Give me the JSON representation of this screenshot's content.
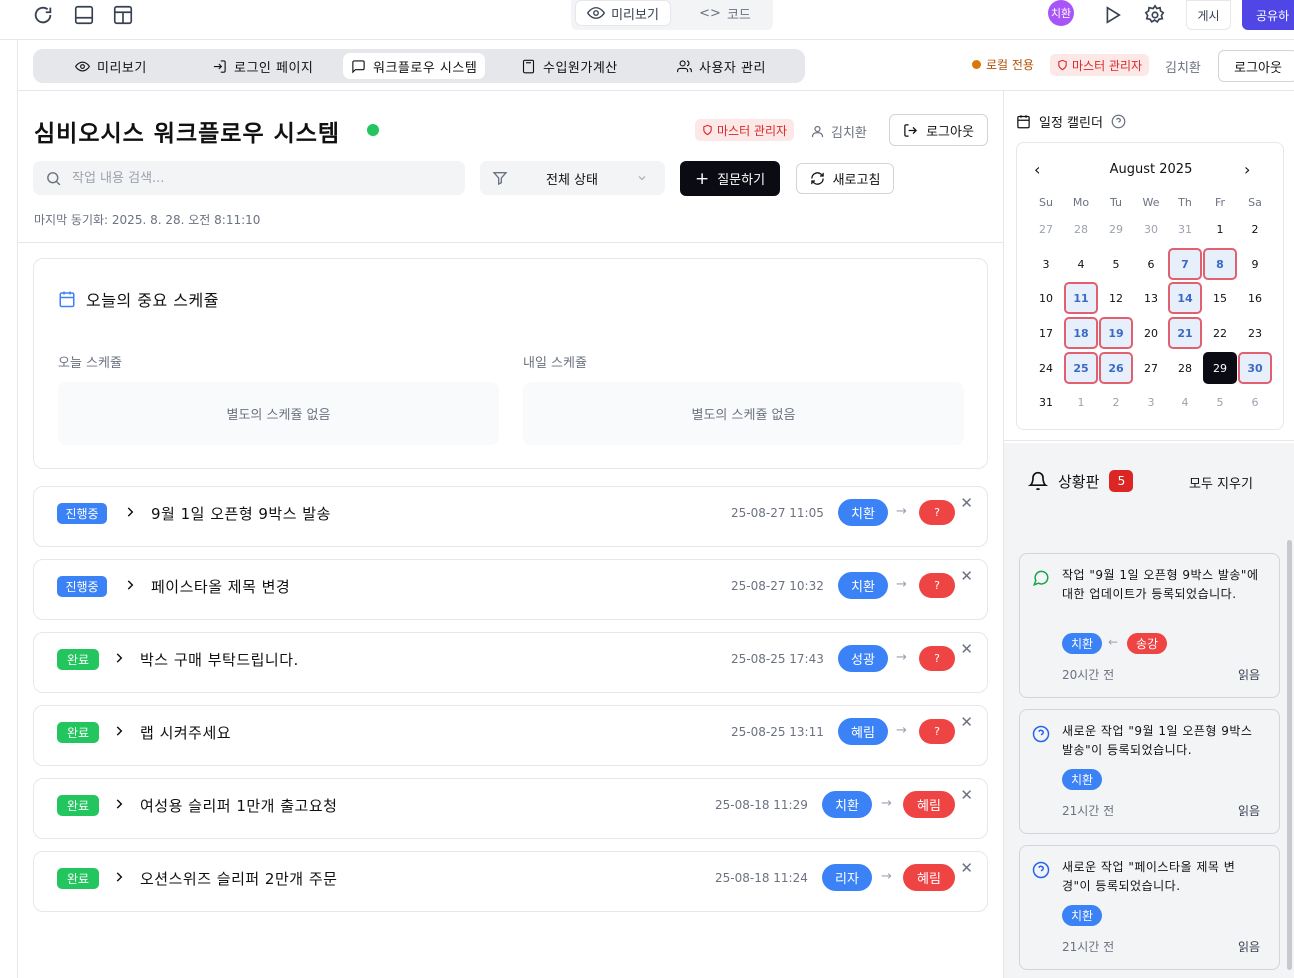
{
  "toolbar": {
    "preview_label": "미리보기",
    "code_label": "코드",
    "avatar_text": "치환",
    "post_label": "게시",
    "share_label": "공유하"
  },
  "nav": {
    "items": [
      {
        "label": "미리보기",
        "icon": "eye-icon"
      },
      {
        "label": "로그인 페이지",
        "icon": "login-icon"
      },
      {
        "label": "워크플로우 시스템",
        "icon": "chat-icon",
        "active": true
      },
      {
        "label": "수입원가계산",
        "icon": "calculator-icon"
      },
      {
        "label": "사용자 관리",
        "icon": "users-icon"
      }
    ],
    "local_only": "로컬 전용",
    "master_admin": "마스터 관리자",
    "user_name": "김치환",
    "logout": "로그아웃"
  },
  "header": {
    "title": "심비오시스 워크플로우 시스템",
    "master_admin": "마스터 관리자",
    "user_name": "김치환",
    "logout": "로그아웃",
    "search_placeholder": "작업 내용 검색...",
    "filter_label": "전체 상태",
    "ask_label": "질문하기",
    "refresh_label": "새로고침",
    "last_sync": "마지막 동기화: 2025. 8. 28. 오전 8:11:10"
  },
  "today": {
    "title": "오늘의 중요 스케쥴",
    "today_label": "오늘 스케쥴",
    "tomorrow_label": "내일 스케쥴",
    "today_empty": "별도의 스케쥴 없음",
    "tomorrow_empty": "별도의 스케쥴 없음"
  },
  "tasks": [
    {
      "status": "진행중",
      "title": "9월 1일 오픈형 9박스 발송",
      "date": "25-08-27 11:05",
      "from": "치환",
      "to": "?"
    },
    {
      "status": "진행중",
      "title": "페이스타올 제목 변경",
      "date": "25-08-27 10:32",
      "from": "치환",
      "to": "?"
    },
    {
      "status": "완료",
      "title": "박스 구매 부탁드립니다.",
      "date": "25-08-25 17:43",
      "from": "성광",
      "to": "?"
    },
    {
      "status": "완료",
      "title": "랩 시켜주세요",
      "date": "25-08-25 13:11",
      "from": "혜림",
      "to": "?"
    },
    {
      "status": "완료",
      "title": "여성용 슬리퍼 1만개 출고요청",
      "date": "25-08-18 11:29",
      "from": "치환",
      "to": "혜림"
    },
    {
      "status": "완료",
      "title": "오션스위즈 슬리퍼 2만개 주문",
      "date": "25-08-18 11:24",
      "from": "리자",
      "to": "혜림"
    }
  ],
  "calendar": {
    "header": "일정 캘린더",
    "month": "August 2025",
    "weekdays": [
      "Su",
      "Mo",
      "Tu",
      "We",
      "Th",
      "Fr",
      "Sa"
    ],
    "days": [
      "27",
      "28",
      "29",
      "30",
      "31",
      "1",
      "2",
      "3",
      "4",
      "5",
      "6",
      "7",
      "8",
      "9",
      "10",
      "11",
      "12",
      "13",
      "14",
      "15",
      "16",
      "17",
      "18",
      "19",
      "20",
      "21",
      "22",
      "23",
      "24",
      "25",
      "26",
      "27",
      "28",
      "29",
      "30",
      "31",
      "1",
      "2",
      "3",
      "4",
      "5",
      "6"
    ],
    "other_month_indices": [
      0,
      1,
      2,
      3,
      4,
      36,
      37,
      38,
      39,
      40,
      41
    ],
    "marked_indices": [
      11,
      12,
      15,
      18,
      22,
      23,
      25,
      29,
      30,
      34
    ],
    "today_index": 33
  },
  "status_board": {
    "title": "상황판",
    "count": "5",
    "clear_all": "모두 지우기",
    "notifications": [
      {
        "icon": "message-icon",
        "text": "작업 \"9월 1일 오픈형 9박스 발송\"에 대한 업데이트가 등록되었습니다.",
        "from": "치환",
        "to": "송강",
        "time": "20시간 전",
        "read": "읽음"
      },
      {
        "icon": "question-icon",
        "text": "새로운 작업 \"9월 1일 오픈형 9박스 발송\"이 등록되었습니다.",
        "from": "치환",
        "time": "21시간 전",
        "read": "읽음"
      },
      {
        "icon": "question-icon",
        "text": "새로운 작업 \"페이스타올 제목 변경\"이 등록되었습니다.",
        "from": "치환",
        "time": "21시간 전",
        "read": "읽음"
      }
    ]
  }
}
